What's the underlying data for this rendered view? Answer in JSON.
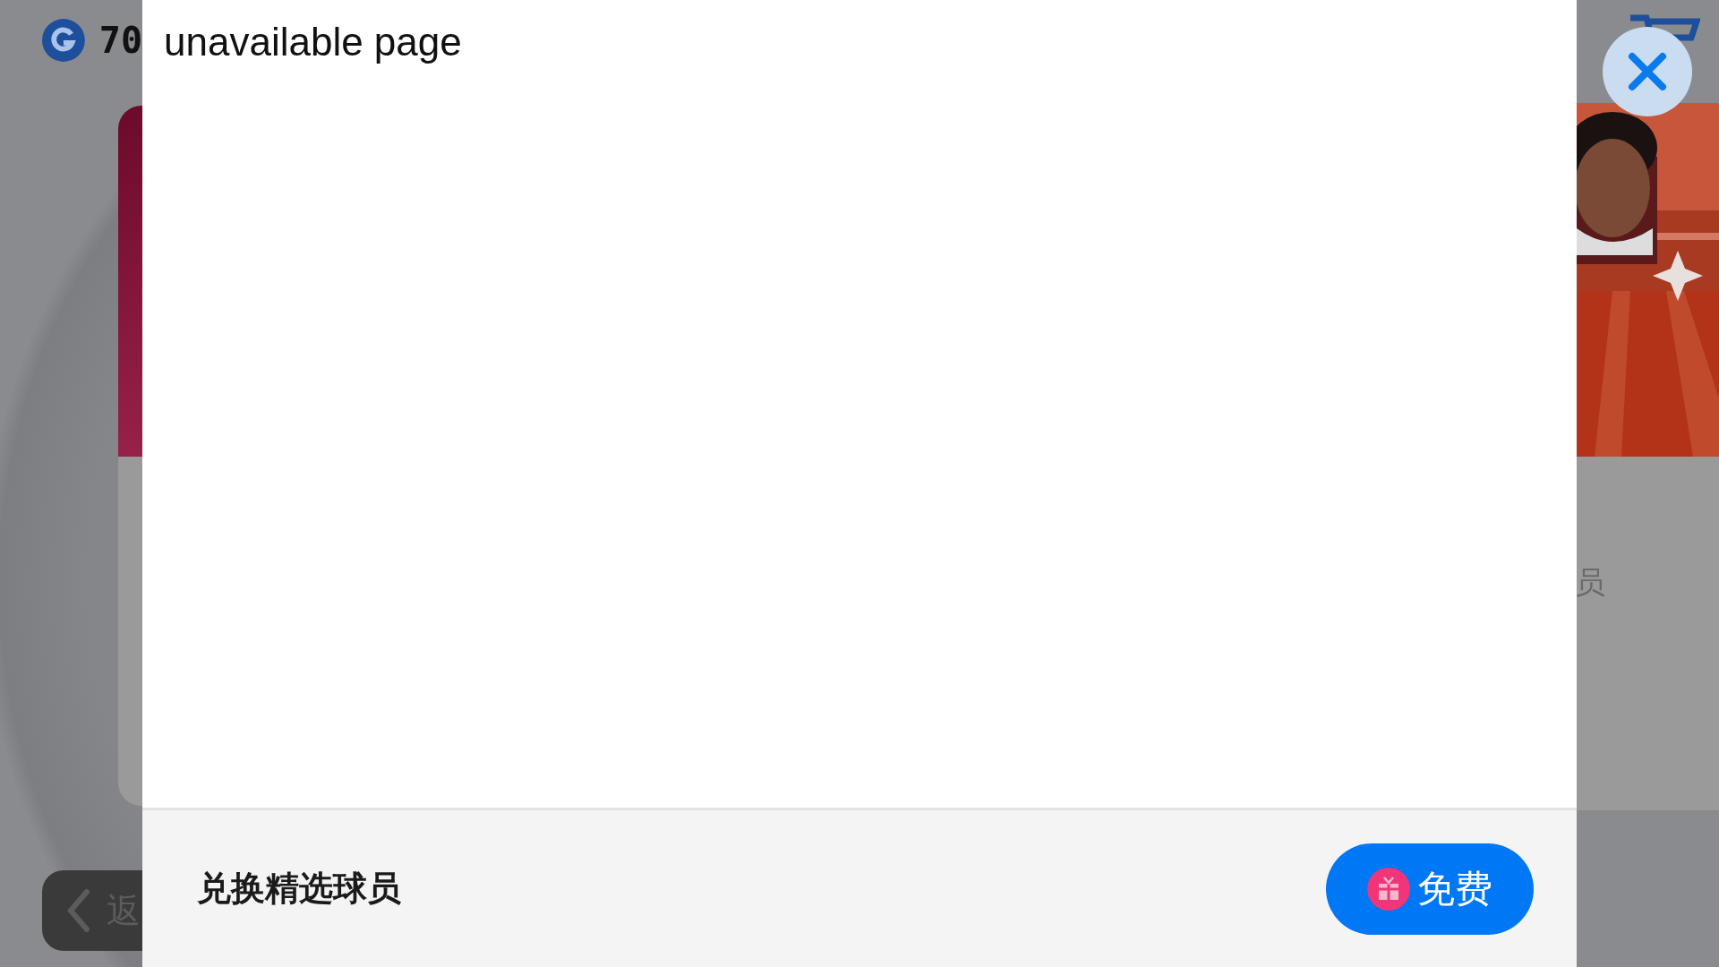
{
  "background": {
    "coins": "70",
    "back_button": "返",
    "side_label": "员"
  },
  "dialog": {
    "message": "unavailable page",
    "offer": "兑换精选球员",
    "claim_button": "免费"
  }
}
